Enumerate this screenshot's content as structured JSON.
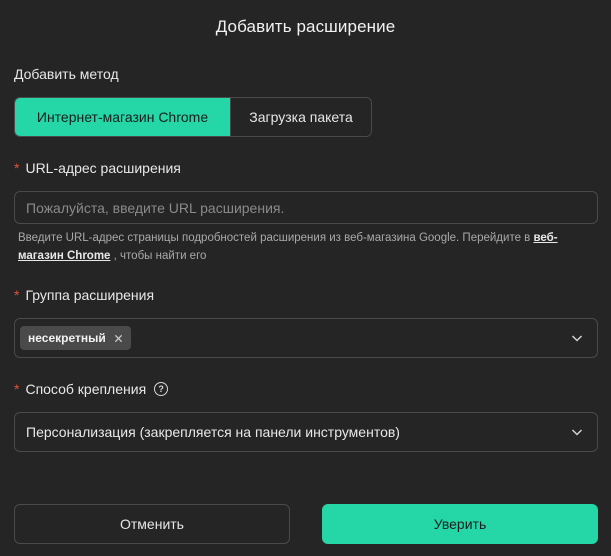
{
  "dialog": {
    "title": "Добавить расширение"
  },
  "method": {
    "label": "Добавить метод",
    "options": [
      {
        "label": "Интернет-магазин Chrome",
        "active": true
      },
      {
        "label": "Загрузка пакета",
        "active": false
      }
    ]
  },
  "url": {
    "label": "URL-адрес расширения",
    "required_mark": "*",
    "value": "",
    "placeholder": "Пожалуйста, введите URL расширения.",
    "hint_before": "Введите URL-адрес страницы подробностей расширения из веб-магазина Google. Перейдите в ",
    "hint_link": "веб-магазин Chrome",
    "hint_after": " , чтобы найти его"
  },
  "group": {
    "label": "Группа расширения",
    "required_mark": "*",
    "tags": [
      "несекретный"
    ]
  },
  "pin": {
    "label": "Способ крепления",
    "required_mark": "*",
    "value": "Персонализация (закрепляется на панели инструментов)"
  },
  "footer": {
    "cancel_label": "Отменить",
    "confirm_label": "Уверить"
  },
  "colors": {
    "accent": "#25d6a6",
    "background": "#252525",
    "required": "#e0533f"
  }
}
